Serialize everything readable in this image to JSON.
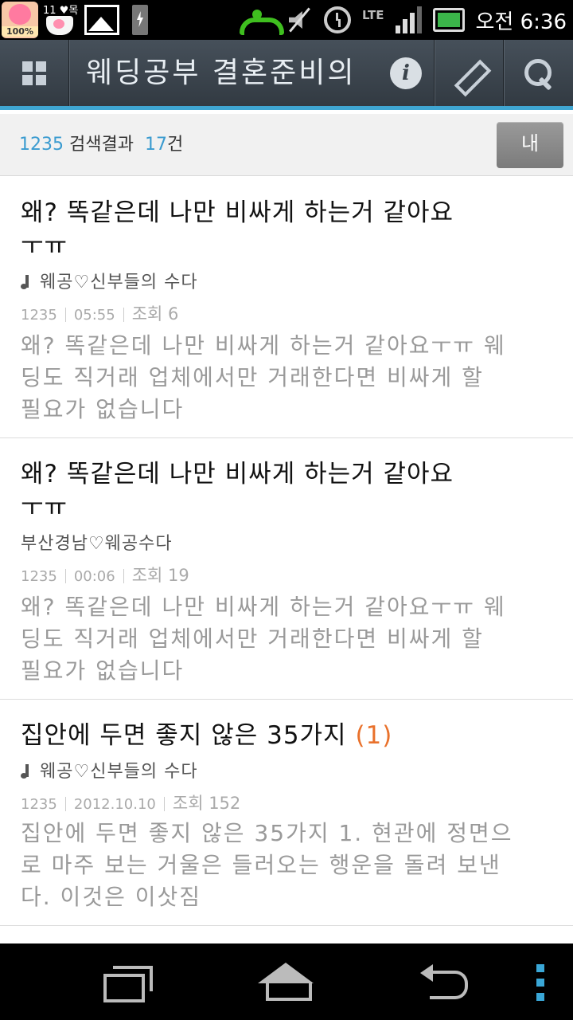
{
  "status_bar": {
    "badge_percent": "100%",
    "notify_text": "11 ♥목",
    "clock": "오전 6:36",
    "network": "LTE",
    "signal_level": 0.75,
    "icons": [
      "app-badge-icon",
      "cup-icon",
      "image-icon",
      "battery-charging-icon",
      "phone-icon",
      "mute-icon",
      "alarm-icon",
      "signal-icon",
      "battery-icon"
    ]
  },
  "app_bar": {
    "title": "웨딩공부 결혼준비의",
    "icons": [
      "grid-menu-icon",
      "info-icon",
      "pencil-icon",
      "search-icon"
    ]
  },
  "results_header": {
    "query": "1235",
    "label": "검색결과",
    "count": "17",
    "count_suffix": "건",
    "my_button_label": "내"
  },
  "results": [
    {
      "title": "왜? 똑같은데 나만 비싸게 하는거 같아요ㅜㅠ",
      "reply_count": "",
      "cafe": "웨공♡신부들의 수다",
      "has_note_icon": true,
      "query": "1235",
      "time": "05:55",
      "views": "조회 6",
      "preview": "왜? 똑같은데 나만 비싸게 하는거 같아요ㅜㅠ 웨딩도 직거래 업체에서만 거래한다면 비싸게 할 필요가 없습니다"
    },
    {
      "title": "왜? 똑같은데 나만 비싸게 하는거 같아요ㅜㅠ",
      "reply_count": "",
      "cafe": "부산경남♡웨공수다",
      "has_note_icon": false,
      "query": "1235",
      "time": "00:06",
      "views": "조회 19",
      "preview": "왜? 똑같은데 나만 비싸게 하는거 같아요ㅜㅠ 웨딩도 직거래 업체에서만 거래한다면 비싸게 할 필요가 없습니다"
    },
    {
      "title": "집안에 두면 좋지 않은 35가지",
      "reply_count": "(1)",
      "cafe": "웨공♡신부들의 수다",
      "has_note_icon": true,
      "query": "1235",
      "time": "2012.10.10",
      "views": "조회 152",
      "preview": "집안에 두면 좋지 않은 35가지 1. 현관에 정면으로 마주 보는 거울은 들러오는 행운을 돌려 보낸다. 이것은 이삿짐"
    }
  ],
  "nav_bar": {
    "icons": [
      "recent-apps-icon",
      "home-icon",
      "back-icon",
      "menu-icon"
    ]
  },
  "colors": {
    "accent": "#3fa6d2",
    "count_blue": "#3a9bd0",
    "reply_orange": "#e9712b",
    "app_bar": "#3b444c"
  }
}
